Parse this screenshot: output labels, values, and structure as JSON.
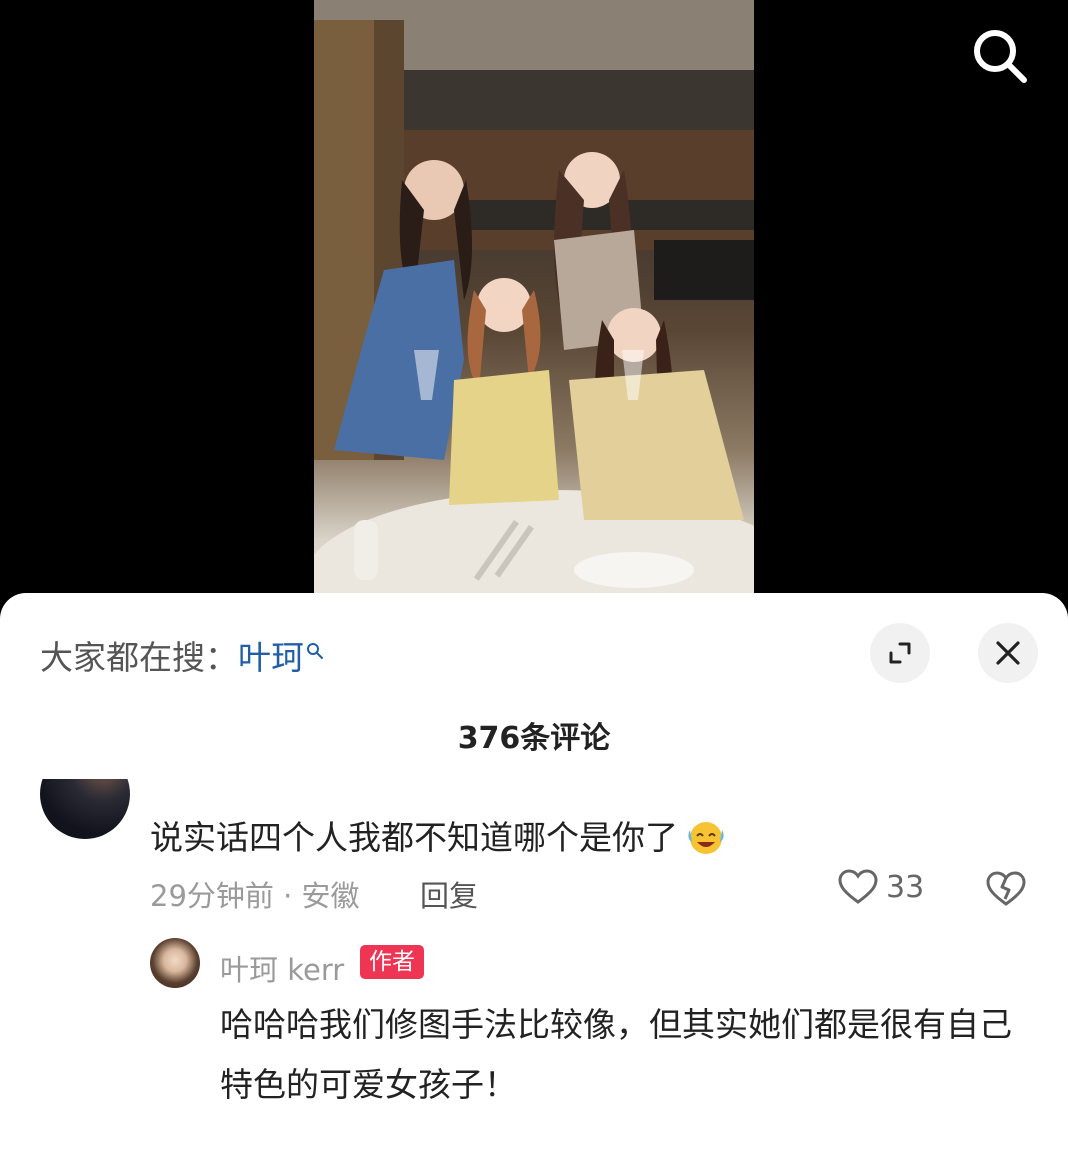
{
  "header": {
    "search_icon": "search-icon"
  },
  "photo": {
    "description_icon": "photo"
  },
  "sheet": {
    "search_hint_prefix": "大家都在搜：",
    "search_keyword": "叶珂",
    "keyword_icon": "small-search-icon",
    "expand_icon": "expand-icon",
    "close_icon": "close-icon",
    "comment_count": "376条评论"
  },
  "comments": [
    {
      "text": "说实话四个人我都不知道哪个是你了",
      "emoji": "laughing-crying-emoji",
      "meta": "29分钟前 · 安徽",
      "reply_label": "回复",
      "likes": "33",
      "like_icon": "heart-outline-icon",
      "dislike_icon": "broken-heart-icon"
    }
  ],
  "reply": {
    "author": "叶珂 kerr",
    "badge": "作者",
    "text": "哈哈哈我们修图手法比较像，但其实她们都是很有自己特色的可爱女孩子！"
  }
}
